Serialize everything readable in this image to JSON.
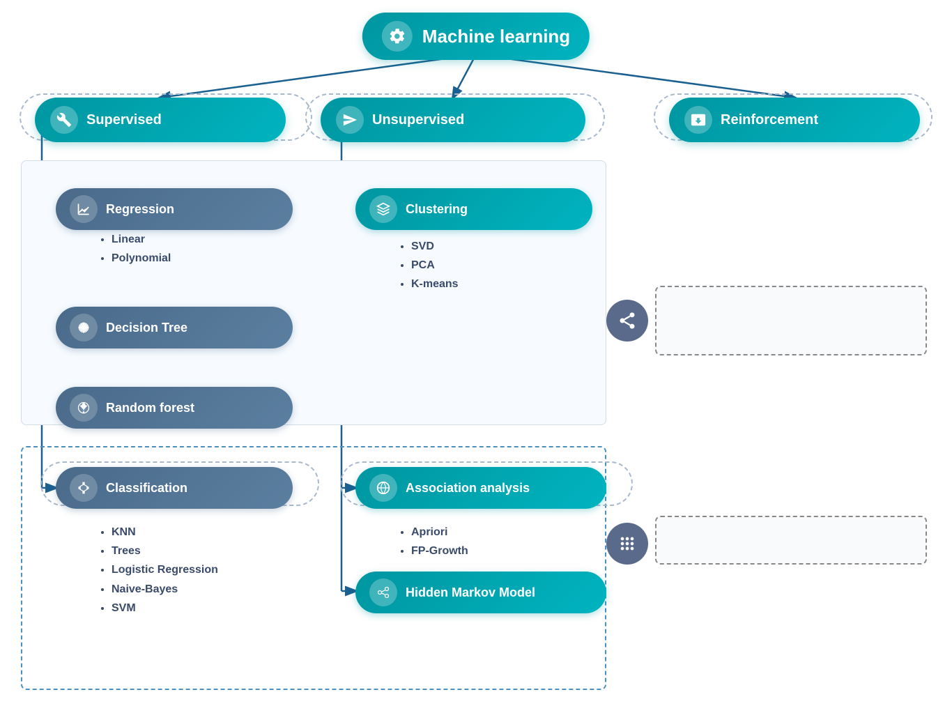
{
  "diagram": {
    "title": "Machine learning",
    "top_node": {
      "label": "Machine learning",
      "icon": "⚙️"
    },
    "level1": [
      {
        "id": "supervised",
        "label": "Supervised",
        "icon": "🔧"
      },
      {
        "id": "unsupervised",
        "label": "Unsupervised",
        "icon": "✈️"
      },
      {
        "id": "reinforcement",
        "label": "Reinforcement",
        "icon": "⬛"
      }
    ],
    "level2": [
      {
        "id": "regression",
        "label": "Regression",
        "parent": "supervised",
        "type": "steel",
        "icon": "📊"
      },
      {
        "id": "decision_tree",
        "label": "Decision Tree",
        "parent": "supervised",
        "type": "steel",
        "icon": "🌲"
      },
      {
        "id": "random_forest",
        "label": "Random forest",
        "parent": "supervised",
        "type": "steel",
        "icon": "🌳"
      },
      {
        "id": "classification",
        "label": "Classification",
        "parent": "supervised",
        "type": "steel",
        "icon": "🔷"
      },
      {
        "id": "clustering",
        "label": "Clustering",
        "parent": "unsupervised",
        "type": "teal",
        "icon": "📚"
      },
      {
        "id": "association",
        "label": "Association analysis",
        "parent": "unsupervised",
        "type": "teal",
        "icon": "🌐"
      },
      {
        "id": "hidden_markov",
        "label": "Hidden Markov Model",
        "parent": "unsupervised",
        "type": "teal",
        "icon": "🔗"
      }
    ],
    "bullets": {
      "regression": [
        "Linear",
        "Polynomial"
      ],
      "clustering": [
        "SVD",
        "PCA",
        "K-means"
      ],
      "classification": [
        "KNN",
        "Trees",
        "Logistic Regression",
        "Naive-Bayes",
        "SVM"
      ],
      "association": [
        "Apriori",
        "FP-Growth"
      ]
    }
  }
}
